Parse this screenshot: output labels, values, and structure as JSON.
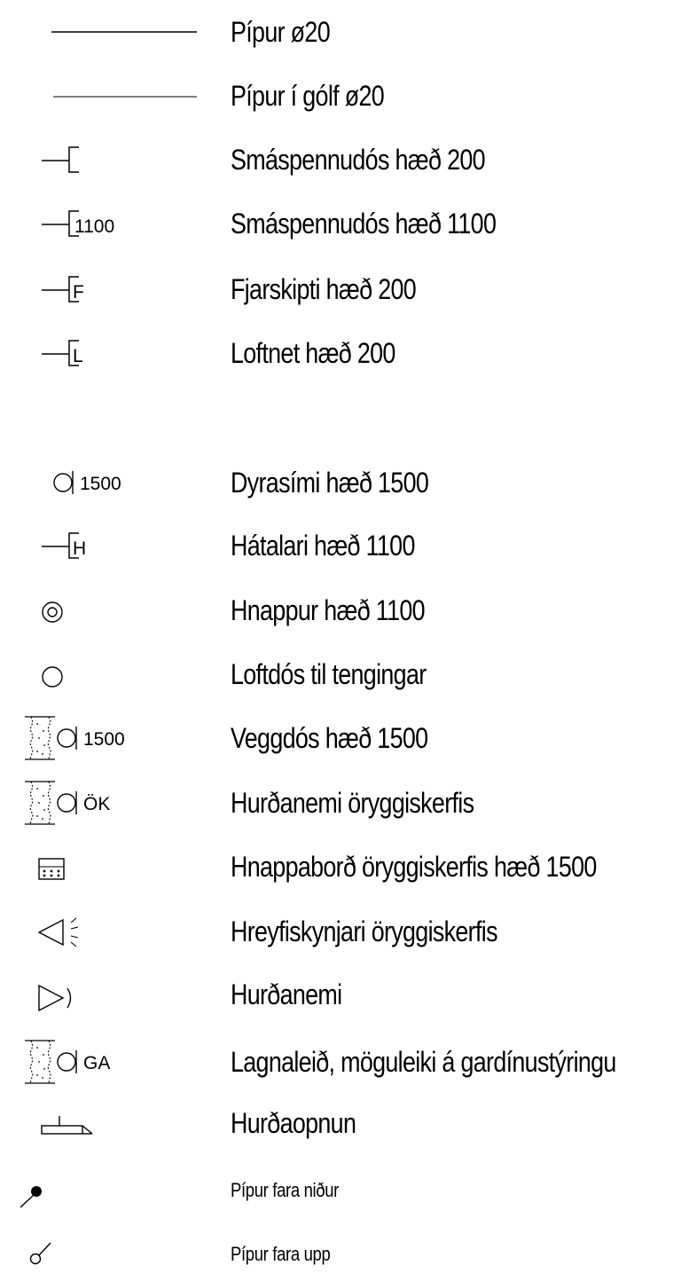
{
  "legend": {
    "items": [
      {
        "label": "Pípur ø20",
        "symbol": "pipe-line-icon"
      },
      {
        "label": "Pípur í gólf ø20",
        "symbol": "floor-pipe-line-icon"
      },
      {
        "label": "Smáspennudós hæð 200",
        "symbol": "low-voltage-box-icon"
      },
      {
        "label": "Smáspennudós hæð 1100",
        "symbol": "low-voltage-box-icon",
        "tag": "1100"
      },
      {
        "label": "Fjarskipti hæð 200",
        "symbol": "telecom-box-icon",
        "tag": "F"
      },
      {
        "label": "Loftnet hæð 200",
        "symbol": "antenna-box-icon",
        "tag": "L"
      },
      {
        "label": "Dyrasími hæð 1500",
        "symbol": "intercom-icon",
        "tag": "1500"
      },
      {
        "label": "Hátalari hæð 1100",
        "symbol": "speaker-box-icon",
        "tag": "H"
      },
      {
        "label": "Hnappur hæð 1100",
        "symbol": "button-icon"
      },
      {
        "label": "Loftdós til tengingar",
        "symbol": "ceiling-box-icon"
      },
      {
        "label": "Veggdós hæð 1500",
        "symbol": "wall-box-icon",
        "tag": "1500"
      },
      {
        "label": "Hurðanemi öryggiskerfis",
        "symbol": "security-door-sensor-icon",
        "tag": "ÖK"
      },
      {
        "label": "Hnappaborð öryggiskerfis hæð 1500",
        "symbol": "security-keypad-icon"
      },
      {
        "label": "Hreyfiskynjari öryggiskerfis",
        "symbol": "motion-sensor-icon"
      },
      {
        "label": "Hurðanemi",
        "symbol": "door-sensor-icon"
      },
      {
        "label": "Lagnaleið, möguleiki á gardínustýringu",
        "symbol": "curtain-control-route-icon",
        "tag": "GA"
      },
      {
        "label": "Hurðaopnun",
        "symbol": "door-opener-icon"
      },
      {
        "label": "Pípur fara niður",
        "symbol": "pipe-down-icon"
      },
      {
        "label": "Pípur fara upp",
        "symbol": "pipe-up-icon"
      }
    ]
  }
}
